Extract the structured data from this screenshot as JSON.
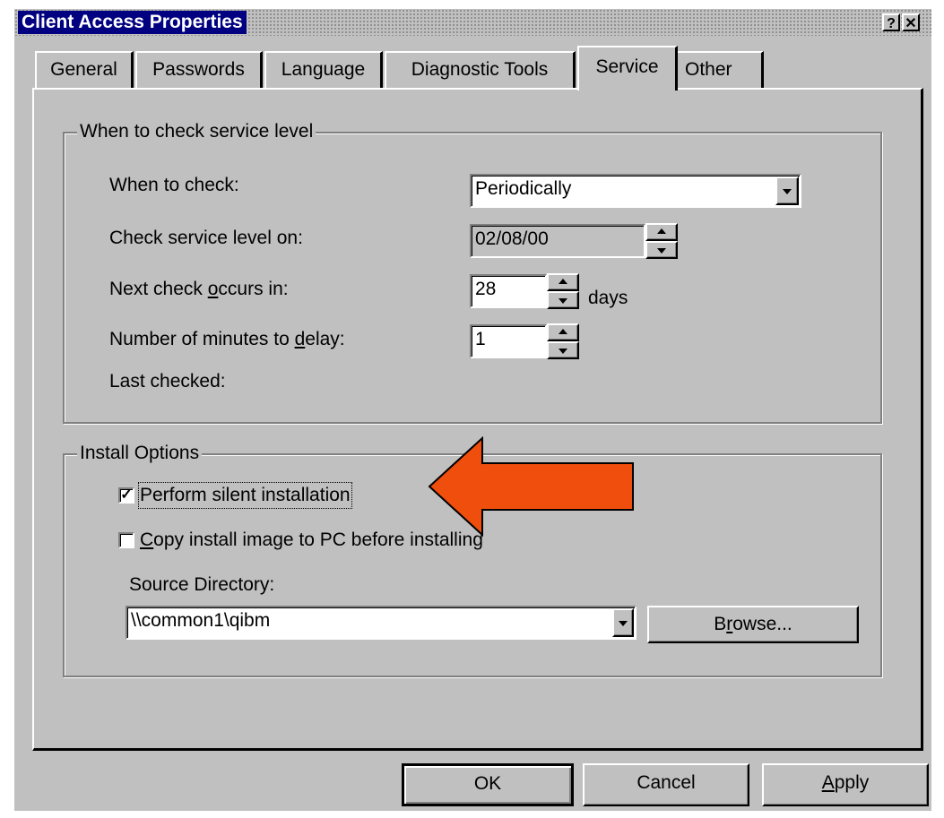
{
  "window": {
    "title": "Client Access Properties",
    "help_label": "?",
    "close_label": "✕"
  },
  "tabs": [
    {
      "label": "General"
    },
    {
      "label": "Passwords"
    },
    {
      "label": "Language"
    },
    {
      "label": "Diagnostic Tools"
    },
    {
      "label": "Service",
      "active": true
    },
    {
      "label": "Other"
    }
  ],
  "service_level": {
    "group_title": "When to check service level",
    "when_label": "When to check:",
    "when_value": "Periodically",
    "check_on_label": "Check service level on:",
    "check_on_value": "02/08/00",
    "next_check_label_pre": "Next check ",
    "next_check_label_ul": "o",
    "next_check_label_post": "ccurs in:",
    "next_check_value": "28",
    "next_check_unit": "days",
    "delay_label_pre": "Number of minutes to ",
    "delay_label_ul": "d",
    "delay_label_post": "elay:",
    "delay_value": "1",
    "last_checked_label": "Last checked:"
  },
  "install_options": {
    "group_title": "Install Options",
    "silent_install_label": "Perform silent installation",
    "silent_install_checked": true,
    "copy_image_label_ul": "C",
    "copy_image_label_post": "opy install image to PC before installing",
    "copy_image_checked": false,
    "source_dir_label": "Source Directory:",
    "source_dir_value": "\\\\common1\\qibm",
    "browse_label_pre": "B",
    "browse_label_ul": "r",
    "browse_label_post": "owse..."
  },
  "buttons": {
    "ok": "OK",
    "cancel": "Cancel",
    "apply_ul": "A",
    "apply_post": "pply"
  },
  "icons": {
    "dropdown": "chevron-down-icon",
    "spinner": "spinner-arrows-icon",
    "checkmark": "checkmark-icon",
    "annotation_arrow": "left-arrow-icon"
  },
  "colors": {
    "title_bg": "#000080",
    "dialog_bg": "#c0c0c0",
    "annotation_arrow": "#f04e0c"
  }
}
